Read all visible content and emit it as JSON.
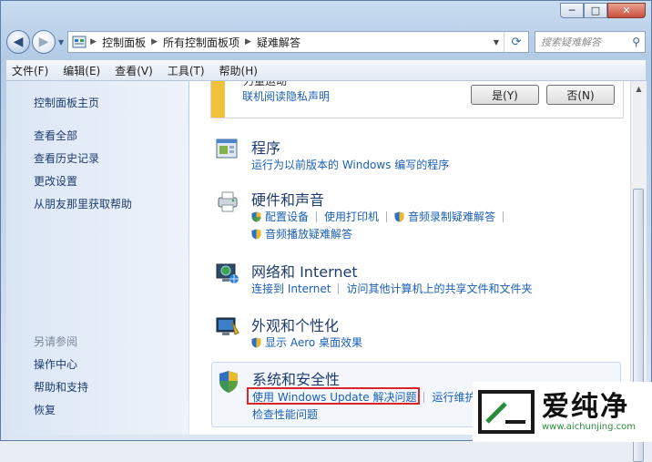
{
  "window": {
    "buttons": {
      "minimize": "─",
      "maximize": "□",
      "close": "✕"
    }
  },
  "nav": {
    "back_icon": "back-arrow-icon",
    "forward_icon": "forward-arrow-icon",
    "breadcrumb": [
      "控制面板",
      "所有控制面板项",
      "疑难解答"
    ],
    "search_placeholder": "搜索疑难解答"
  },
  "menu": [
    "文件(F)",
    "编辑(E)",
    "查看(V)",
    "工具(T)",
    "帮助(H)"
  ],
  "sidebar": {
    "links": [
      "控制面板主页",
      "查看全部",
      "查看历史记录",
      "更改设置",
      "从朋友那里获取帮助"
    ],
    "see_also_heading": "另请参阅",
    "see_also": [
      "操作中心",
      "帮助和支持",
      "恢复"
    ]
  },
  "notice": {
    "cut_text": "力量运动",
    "link": "联机阅读隐私声明",
    "yes_label": "是(Y)",
    "no_label": "否(N)"
  },
  "categories": [
    {
      "title": "程序",
      "links": [
        [
          "运行为以前版本的 Windows 编写的程序"
        ]
      ]
    },
    {
      "title": "硬件和声音",
      "links": [
        [
          "配置设备",
          "使用打印机",
          "音频录制疑难解答"
        ],
        [
          "音频播放疑难解答"
        ]
      ]
    },
    {
      "title": "网络和 Internet",
      "links": [
        [
          "连接到 Internet",
          "访问其他计算机上的共享文件和文件夹"
        ]
      ]
    },
    {
      "title": "外观和个性化",
      "links": [
        [
          "显示 Aero 桌面效果"
        ]
      ]
    },
    {
      "title": "系统和安全性",
      "links": [
        [
          "使用 Windows Update 解决问题",
          "运行维护"
        ],
        [
          "检查性能问题"
        ]
      ]
    }
  ],
  "watermark": {
    "brand": "爱纯净",
    "url": "www.aichunjing.com"
  },
  "colors": {
    "link": "#1a5fb4",
    "highlight": "#d9242a",
    "notice_bar": "#f0c23a"
  }
}
